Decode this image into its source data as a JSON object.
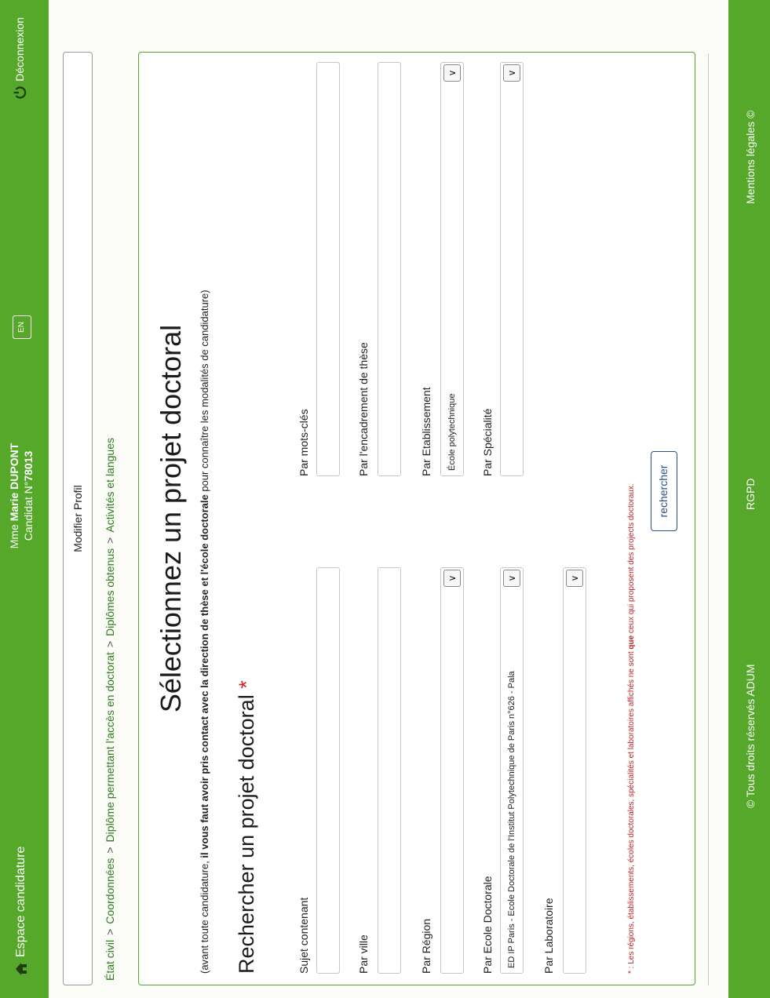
{
  "header": {
    "brand": "Espace candidature",
    "user_prefix": "Mme",
    "user_name": "Marie DUPONT",
    "candidate_label": "Candidat N°",
    "candidate_number": "78013",
    "lang_button": "EN",
    "logout": "Déconnexion"
  },
  "profile_button": "Modifier Profil",
  "breadcrumb": [
    "État civil",
    "Coordonnées",
    "Diplôme permettant l'accès en doctorat",
    "Diplômes obtenus",
    "Activités et langues"
  ],
  "breadcrumb_sep": ">",
  "main": {
    "title": "Sélectionnez un projet doctoral",
    "intro_prefix": "(avant toute candidature, ",
    "intro_bold1": "il vous faut avoir pris contact avec la direction de thèse et l'école doctorale",
    "intro_suffix": " pour connaître les modalités de candidature)",
    "subtitle": "Rechercher un projet doctoral",
    "subtitle_star": "*"
  },
  "form": {
    "sujet_label": "Sujet contenant",
    "sujet_value": "",
    "motscles_label": "Par mots-clés",
    "motscles_value": "",
    "ville_label": "Par ville",
    "ville_value": "",
    "encadrement_label": "Par l'encadrement de thèse",
    "encadrement_value": "",
    "region_label": "Par Région",
    "region_value": "",
    "etablissement_label": "Par Etablissement",
    "etablissement_value": "École polytechnique",
    "ecole_label": "Par Ecole Doctorale",
    "ecole_value": "ED IP Paris - Ecole Doctorale de l'Institut Polytechnique de Paris n°626 - Pala",
    "specialite_label": "Par Spécialité",
    "specialite_value": "",
    "labo_label": "Par Laboratoire",
    "labo_value": "",
    "note_prefix": "* : Les régions, établissements, écoles doctorales, spécialités et laboratoires affichés ne sont ",
    "note_bold": "que",
    "note_suffix": " ceux qui proposent des projects doctoraux.",
    "search_button": "rechercher",
    "dropdown_glyph": "∨"
  },
  "footer": {
    "rights": "© Tous droits réservés ADUM",
    "rgpd": "RGPD",
    "legal": "Mentions légales ©"
  },
  "colors": {
    "brand_green": "#55a82a",
    "link_green": "#2d7d1b",
    "note_red": "#c41e1e",
    "button_blue": "#2c4f8a"
  }
}
